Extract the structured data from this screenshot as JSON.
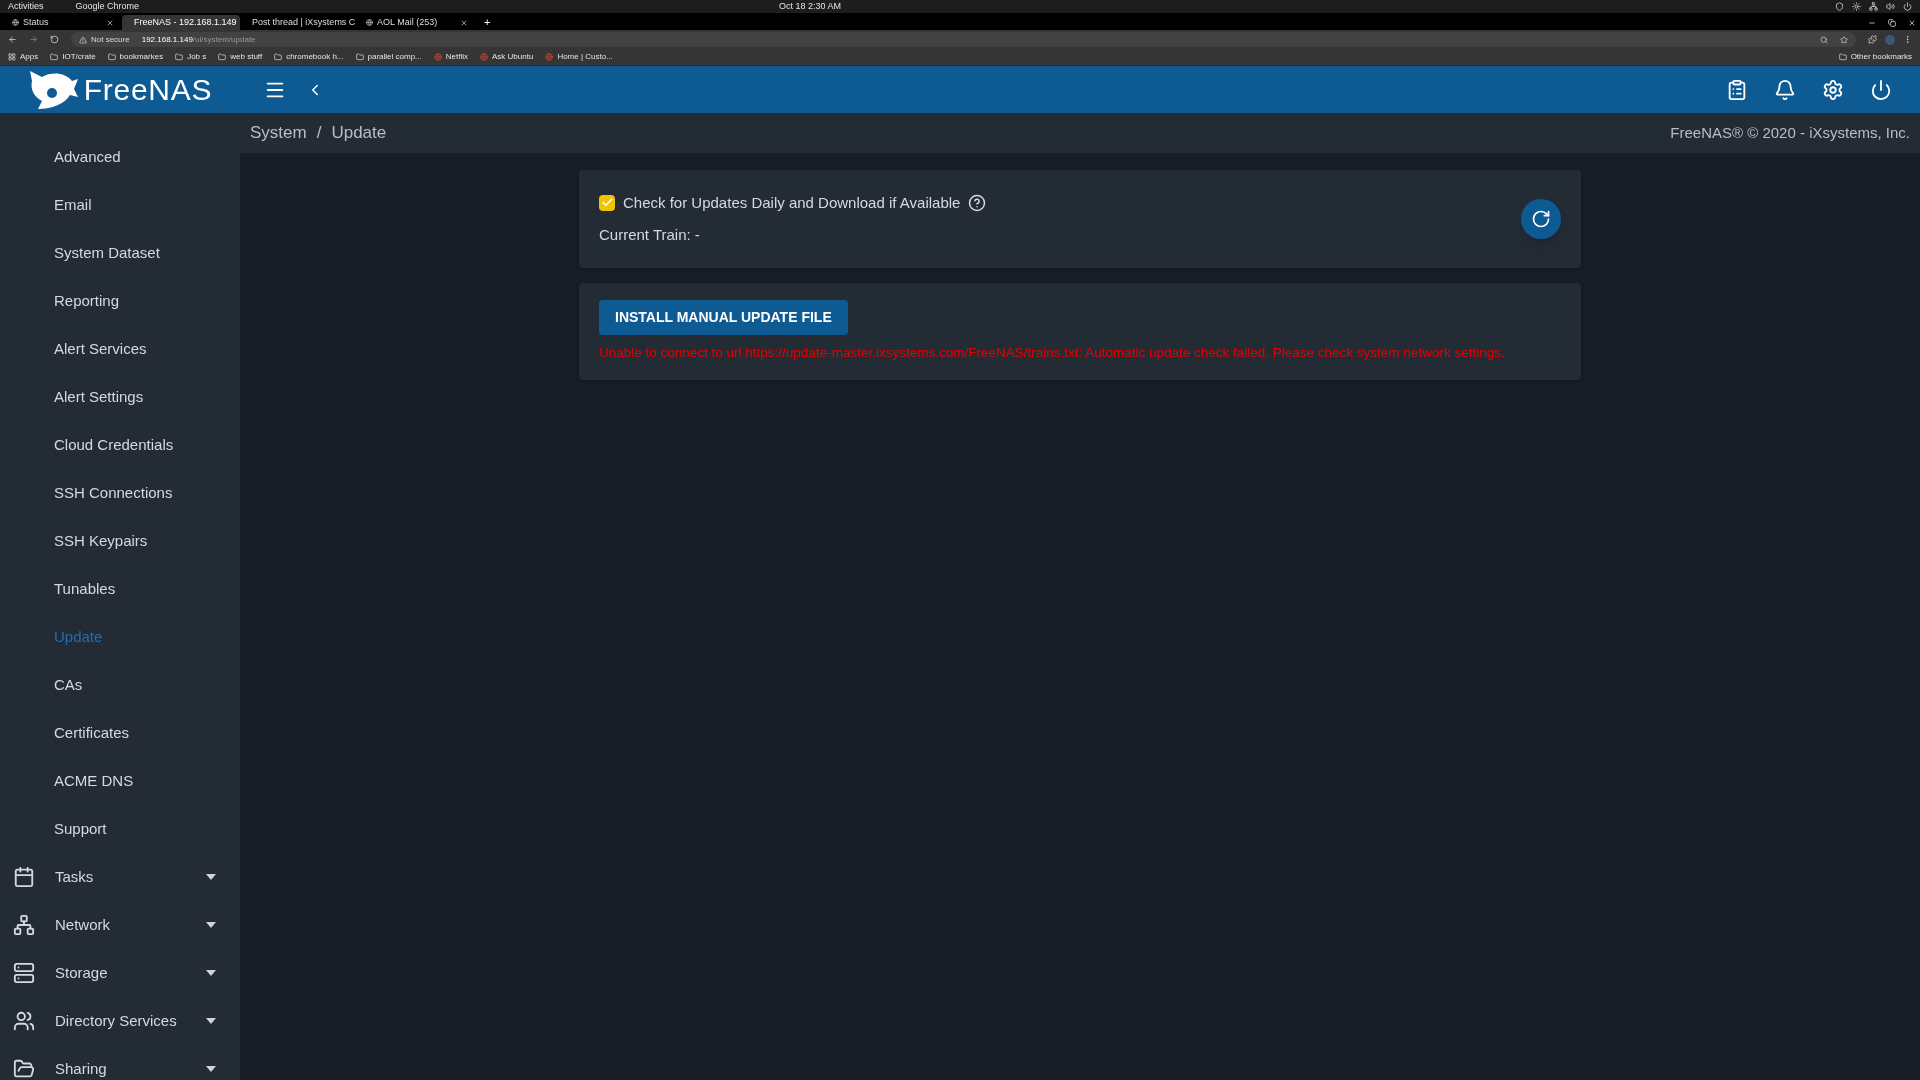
{
  "os_bar": {
    "activities": "Activities",
    "app": "Google Chrome",
    "clock": "Oct 18   2:30 AM"
  },
  "browser": {
    "tabs": [
      {
        "label": "Status",
        "selected": false
      },
      {
        "label": "FreeNAS - 192.168.1.149",
        "selected": true
      },
      {
        "label": "Post thread | iXsystems C",
        "selected": false
      },
      {
        "label": "AOL Mail (253)",
        "selected": false
      }
    ],
    "new_tab": "+",
    "security": "Not secure",
    "url_host": "192.168.1.149",
    "url_path": "/ui/system/update",
    "bookmarks": [
      {
        "label": "Apps",
        "kind": "apps"
      },
      {
        "label": "IOT/crate",
        "kind": "folder"
      },
      {
        "label": "bookmarkes",
        "kind": "folder"
      },
      {
        "label": "Job s",
        "kind": "folder"
      },
      {
        "label": "web stuff",
        "kind": "folder"
      },
      {
        "label": "chromebook h...",
        "kind": "folder"
      },
      {
        "label": "parallel comp...",
        "kind": "folder"
      },
      {
        "label": "Netflix",
        "kind": "site"
      },
      {
        "label": "Ask Ubuntu",
        "kind": "site"
      },
      {
        "label": "Home | Custo...",
        "kind": "site"
      }
    ],
    "other_bookmarks": "Other bookmarks"
  },
  "header": {
    "logo": "FreeNAS"
  },
  "sidebar": {
    "items": [
      {
        "label": "Advanced",
        "selected": false,
        "kind": "sub"
      },
      {
        "label": "Email",
        "selected": false,
        "kind": "sub"
      },
      {
        "label": "System Dataset",
        "selected": false,
        "kind": "sub"
      },
      {
        "label": "Reporting",
        "selected": false,
        "kind": "sub"
      },
      {
        "label": "Alert Services",
        "selected": false,
        "kind": "sub"
      },
      {
        "label": "Alert Settings",
        "selected": false,
        "kind": "sub"
      },
      {
        "label": "Cloud Credentials",
        "selected": false,
        "kind": "sub"
      },
      {
        "label": "SSH Connections",
        "selected": false,
        "kind": "sub"
      },
      {
        "label": "SSH Keypairs",
        "selected": false,
        "kind": "sub"
      },
      {
        "label": "Tunables",
        "selected": false,
        "kind": "sub"
      },
      {
        "label": "Update",
        "selected": true,
        "kind": "sub"
      },
      {
        "label": "CAs",
        "selected": false,
        "kind": "sub"
      },
      {
        "label": "Certificates",
        "selected": false,
        "kind": "sub"
      },
      {
        "label": "ACME DNS",
        "selected": false,
        "kind": "sub"
      },
      {
        "label": "Support",
        "selected": false,
        "kind": "sub"
      },
      {
        "label": "Tasks",
        "selected": false,
        "kind": "tasks"
      },
      {
        "label": "Network",
        "selected": false,
        "kind": "network"
      },
      {
        "label": "Storage",
        "selected": false,
        "kind": "storage"
      },
      {
        "label": "Directory Services",
        "selected": false,
        "kind": "directory"
      },
      {
        "label": "Sharing",
        "selected": false,
        "kind": "sharing"
      }
    ]
  },
  "breadcrumb": {
    "items": [
      "System",
      "Update"
    ],
    "separator": "/"
  },
  "copyright": "FreeNAS® © 2020 - iXsystems, Inc.",
  "update_card": {
    "auto_check": {
      "label": "Check for Updates Daily and Download if Available",
      "checked": true
    },
    "current_train": "Current Train: -"
  },
  "manual_card": {
    "button": "INSTALL MANUAL UPDATE FILE",
    "error": "Unable to connect to url https://update-master.ixsystems.com/FreeNAS/trains.txt: Automatic update check failed. Please check system network settings."
  }
}
